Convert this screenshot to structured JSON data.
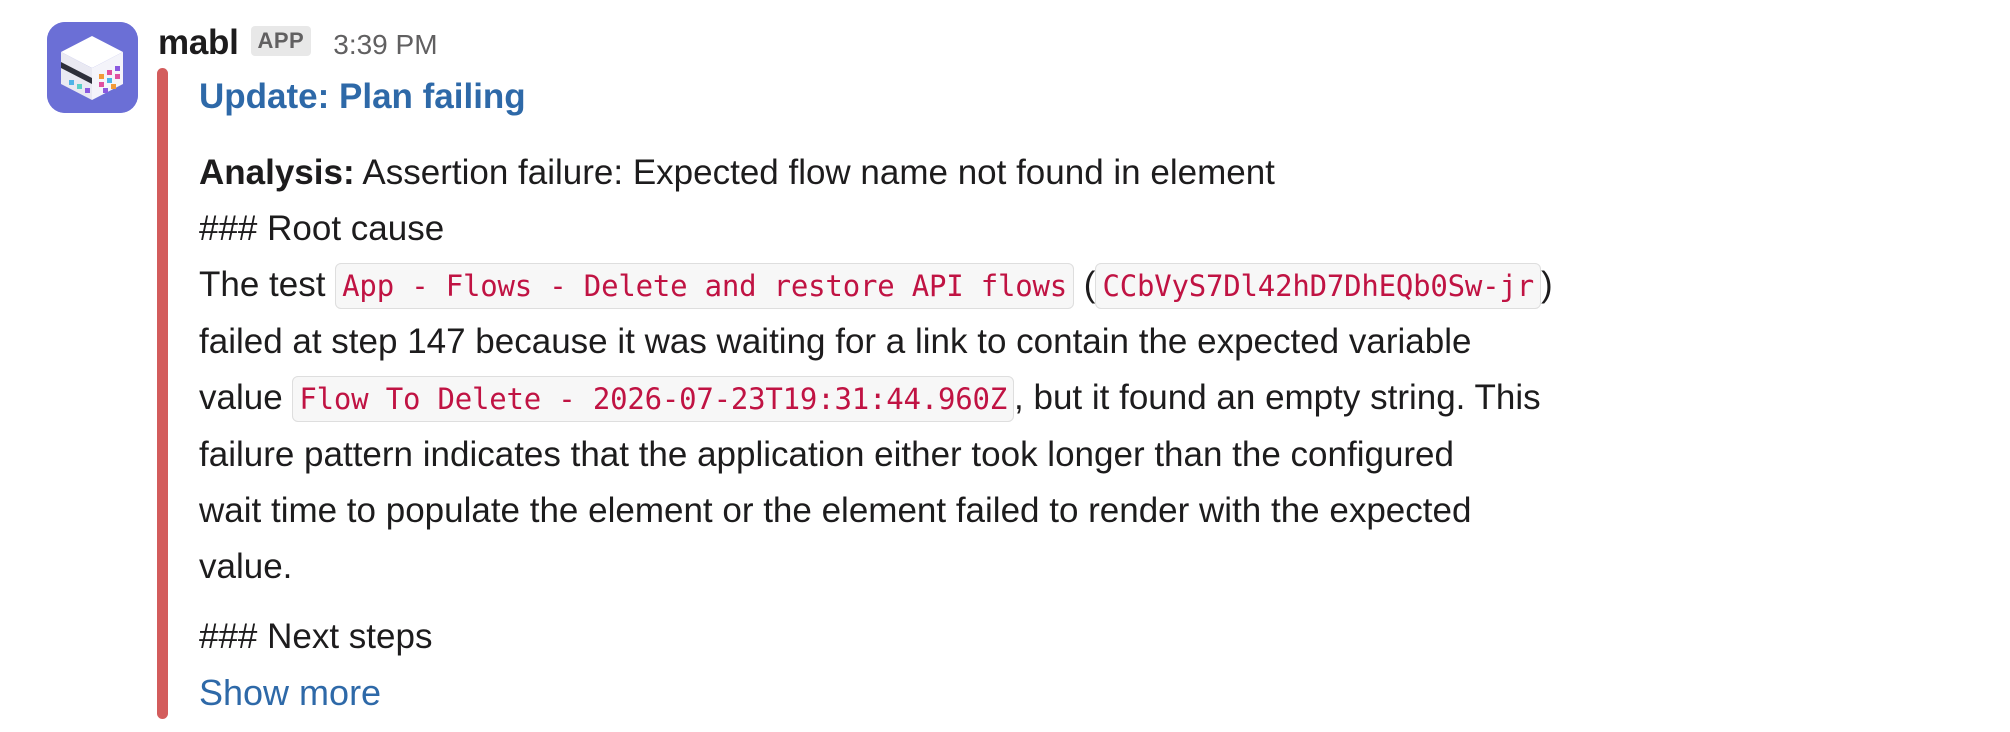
{
  "message": {
    "sender": "mabl",
    "badge": "APP",
    "timestamp": "3:39 PM",
    "avatar_icon": "mabl-logo-icon",
    "accent_color": "#d35c5c"
  },
  "attachment": {
    "title": "Update: Plan failing",
    "analysis_label": "Analysis:",
    "analysis_text": " Assertion failure: Expected flow name not found in element",
    "root_cause_heading": "### Root cause",
    "p1_prefix": "The test ",
    "test_name_code": "App - Flows - Delete and restore API flows",
    "paren_open": " (",
    "test_id_code": "CCbVyS7Dl42hD7DhEQb0Sw-jr",
    "paren_close": ")",
    "line2": "failed at step 147 because it was waiting for a link to contain the expected variable",
    "line3_prefix": "value ",
    "variable_code": "Flow To Delete - 2026-07-23T19:31:44.960Z",
    "line3_suffix": ", but it found an empty string. This",
    "line4": "failure pattern indicates that the application either took longer than the configured",
    "line5": "wait time to populate the element or the element failed to render with the expected",
    "line6": "value.",
    "next_steps_heading": "### Next steps",
    "show_more": "Show more"
  }
}
